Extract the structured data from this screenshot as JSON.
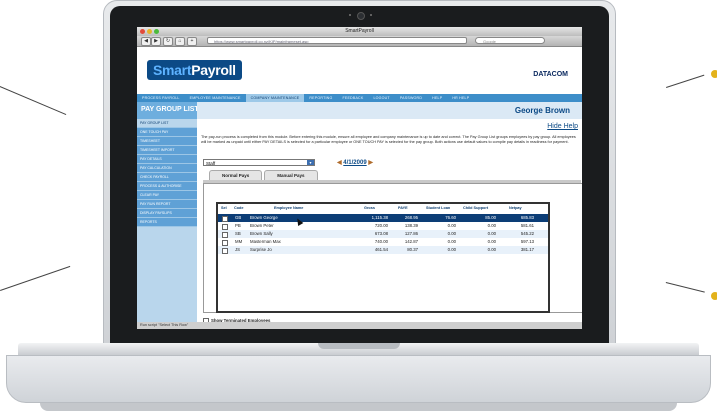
{
  "window": {
    "title": "SmartPayroll"
  },
  "browser": {
    "url": "https://www.smartpayroll.co.nz/KIP/mainframeset.asp",
    "search_placeholder": "Google"
  },
  "brand": {
    "logo_smart": "Smart",
    "logo_payroll": "Payroll",
    "partner": "DATACOM"
  },
  "nav": [
    "PROCESS PAYROLL",
    "EMPLOYEE MAINTENANCE",
    "COMPANY MAINTENANCE",
    "REPORTING",
    "FEEDBACK",
    "LOGOUT",
    "PASSWORD",
    "HELP",
    "HR HELP"
  ],
  "page": {
    "title": "PAY GROUP LIST",
    "user": "George Brown",
    "hide_help": "Hide Help"
  },
  "sidebar": [
    "PAY GROUP LIST",
    "ONE TOUCH PAY",
    "TIMESHEET",
    "TIMESHEET IMPORT",
    "PAY DETAILS",
    "PAY CALCULATION",
    "CHECK PAYROLL",
    "PROCESS & AUTHORISE",
    "CLEAR PAY",
    "PAY RUN REPORT",
    "DISPLAY PAYSLIPS",
    "REPORTS"
  ],
  "description": "The pay-run process is completed from this module. Before entering this module, ensure all employee and company maintenance is up to date and correct. The Pay Group List groups employees by pay group. All employees will be marked as unpaid until either PAY DETAILS is selected for a particular employee or ONE TOUCH PAY is selected for the pay group. Both actions use default values to compile pay details in readiness for payment.",
  "group_select": {
    "value": "Staff"
  },
  "pay_date": "4/1/2009",
  "tabs": [
    "Normal Pays",
    "Manual Pays"
  ],
  "table": {
    "headers": [
      "Sel",
      "Code",
      "Employee Name",
      "Gross",
      "PAYE",
      "Student Loan",
      "Child Support",
      "Netpay"
    ],
    "rows": [
      {
        "code": "GB",
        "name": "Brown George",
        "gross": "1,115.38",
        "paye": "268.95",
        "student_loan": "76.60",
        "child_support": "85.00",
        "netpay": "685.83"
      },
      {
        "code": "PB",
        "name": "Brown Peter",
        "gross": "720.00",
        "paye": "138.39",
        "student_loan": "0.00",
        "child_support": "0.00",
        "netpay": "581.61"
      },
      {
        "code": "SB",
        "name": "Brown Sally",
        "gross": "673.08",
        "paye": "127.86",
        "student_loan": "0.00",
        "child_support": "0.00",
        "netpay": "545.22"
      },
      {
        "code": "MM",
        "name": "Masterman Max",
        "gross": "740.00",
        "paye": "142.87",
        "student_loan": "0.00",
        "child_support": "0.00",
        "netpay": "597.13"
      },
      {
        "code": "JS",
        "name": "Surprise Jo",
        "gross": "461.54",
        "paye": "80.37",
        "student_loan": "0.00",
        "child_support": "0.00",
        "netpay": "381.17"
      }
    ]
  },
  "show_terminated": "Show Terminated Employees",
  "status": "Run script \"Select This Row\"",
  "colors": {
    "brand_blue": "#0c4a86",
    "nav_blue": "#3d8ec9",
    "selected_row": "#0c3d76",
    "callout": "#e3b21b"
  }
}
